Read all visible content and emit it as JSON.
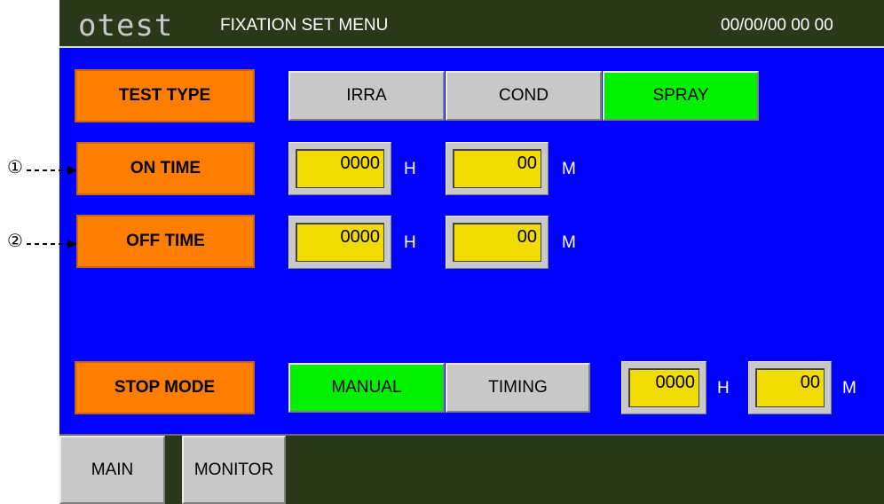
{
  "header": {
    "logo": "otest",
    "title": "FIXATION SET MENU",
    "datetime": "00/00/00 00 00"
  },
  "rows": {
    "test_type": {
      "label": "TEST TYPE",
      "options": [
        "IRRA",
        "COND",
        "SPRAY"
      ],
      "selected": "SPRAY"
    },
    "on_time": {
      "marker": "①",
      "label": "ON TIME",
      "hours": "0000",
      "hours_unit": "H",
      "minutes": "00",
      "minutes_unit": "M"
    },
    "off_time": {
      "marker": "②",
      "label": "OFF TIME",
      "hours": "0000",
      "hours_unit": "H",
      "minutes": "00",
      "minutes_unit": "M"
    },
    "stop_mode": {
      "label": "STOP MODE",
      "options": [
        "MANUAL",
        "TIMING"
      ],
      "selected": "MANUAL",
      "hours": "0000",
      "hours_unit": "H",
      "minutes": "00",
      "minutes_unit": "M"
    }
  },
  "footer": {
    "main_label": "MAIN",
    "monitor_label": "MONITOR"
  },
  "colors": {
    "panel_bg": "#0000ff",
    "bar_bg": "#283818",
    "label_bg": "#ff7d00",
    "selected_bg": "#00f000",
    "field_bg": "#f0dc00",
    "button_bg": "#c8c8c8"
  }
}
